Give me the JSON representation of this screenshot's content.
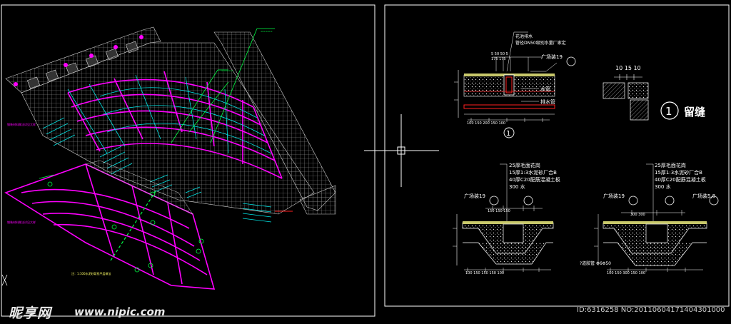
{
  "detail_notes": {
    "planter_drain_line1": "花池排水",
    "planter_drain_line2": "管径DN50级别水量厂家定",
    "water_pipe": "水管",
    "drain_pipe": "排水管",
    "paving_1": "广场装19",
    "paving_2": "广场装19",
    "paving_3": "广场装19",
    "paving_4": "广场装5,8",
    "seam_label": "留缝",
    "seam_dims": "10 15 10",
    "bubble_number": "1"
  },
  "layer_notes_left": [
    "25厚毛面花岗",
    "15厚1:3水泥砂厂合B",
    "40厚C20配筋混凝土板",
    "300 水"
  ],
  "layer_notes_right": [
    "25厚毛面花岗",
    "15厚1:3水泥砂厂合B",
    "40厚C20配筋混凝土板",
    "300 水"
  ],
  "dims": {
    "top_detail_top": "5 50 50 5",
    "top_detail_sub": "175 175",
    "top_detail_bottom": "100 150 200 150 100",
    "mid_left_top": "150 150 150",
    "mid_left_bottom": "100 150 150 150 100",
    "mid_right_top": "300 300",
    "mid_right_bottom": "100 150 300 150 100",
    "drain_pipe_note": "?道胶管 Φ6Φ50"
  },
  "watermark": {
    "logo": "昵享网",
    "url": "www.nipic.com",
    "id": "ID:6316258 NO:20110604171404301000"
  },
  "colors": {
    "background": "#000000",
    "frame": "#ffffff",
    "magenta": "#ff00ff",
    "cyan": "#00e5e5",
    "green": "#00ff44",
    "red": "#ff2020",
    "yellow": "#ffff66"
  }
}
